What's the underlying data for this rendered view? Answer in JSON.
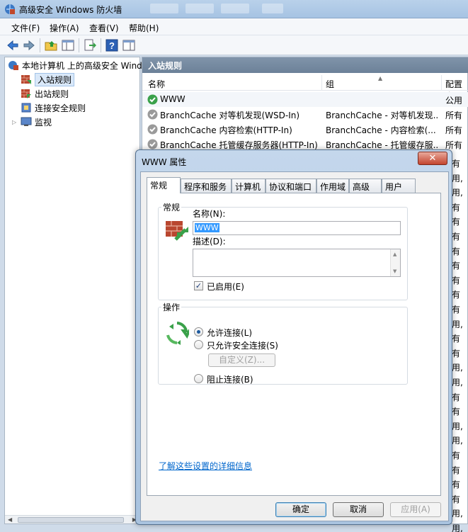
{
  "window": {
    "title": "高级安全 Windows 防火墙"
  },
  "menu": [
    "文件(F)",
    "操作(A)",
    "查看(V)",
    "帮助(H)"
  ],
  "toolbar_icons": [
    "back-arrow-icon",
    "forward-arrow-icon",
    "up-folder-icon",
    "show-hide-tree-icon",
    "export-icon",
    "help-icon",
    "show-action-pane-icon"
  ],
  "tree": {
    "root": "本地计算机 上的高级安全 Windows",
    "items": [
      {
        "label": "入站规则",
        "selected": true
      },
      {
        "label": "出站规则",
        "selected": false
      },
      {
        "label": "连接安全规则",
        "selected": false
      },
      {
        "label": "监视",
        "selected": false
      }
    ]
  },
  "rules_panel": {
    "title": "入站规则",
    "columns": [
      "名称",
      "组",
      "配置文"
    ],
    "rows": [
      {
        "name": "WWW",
        "group": "",
        "profile": "公用"
      },
      {
        "name": "BranchCache 对等机发现(WSD-In)",
        "group": "BranchCache - 对等机发现...",
        "profile": "所有"
      },
      {
        "name": "BranchCache 内容检索(HTTP-In)",
        "group": "BranchCache - 内容检索(...",
        "profile": "所有"
      },
      {
        "name": "BranchCache 托管缓存服务器(HTTP-In)",
        "group": "BranchCache - 托管缓存服...",
        "profile": "所有"
      }
    ],
    "edge_cells": [
      "有",
      "用,",
      "用,",
      "有",
      "有",
      "有",
      "有",
      "有",
      "有",
      "有",
      "有",
      "用,",
      "有",
      "有",
      "用,",
      "用,",
      "有",
      "有",
      "用,",
      "用,",
      "有",
      "有",
      "有",
      "有",
      "用,",
      "用,"
    ]
  },
  "dialog": {
    "title": "WWW 属性",
    "close_glyph": "✕",
    "tabs": [
      "常规",
      "程序和服务",
      "计算机",
      "协议和端口",
      "作用域",
      "高级",
      "用户"
    ],
    "general_group_title": "常规",
    "name_label": "名称(N):",
    "name_value": "WWW",
    "description_label": "描述(D):",
    "description_value": "",
    "enabled_label": "已启用(E)",
    "enabled": true,
    "action_group_title": "操作",
    "options": [
      {
        "label": "允许连接(L)",
        "checked": true
      },
      {
        "label": "只允许安全连接(S)",
        "checked": false
      },
      {
        "label": "阻止连接(B)",
        "checked": false
      }
    ],
    "customize_label": "自定义(Z)...",
    "learn_more_link": "了解这些设置的详细信息",
    "buttons": {
      "ok": "确定",
      "cancel": "取消",
      "apply": "应用(A)"
    }
  }
}
